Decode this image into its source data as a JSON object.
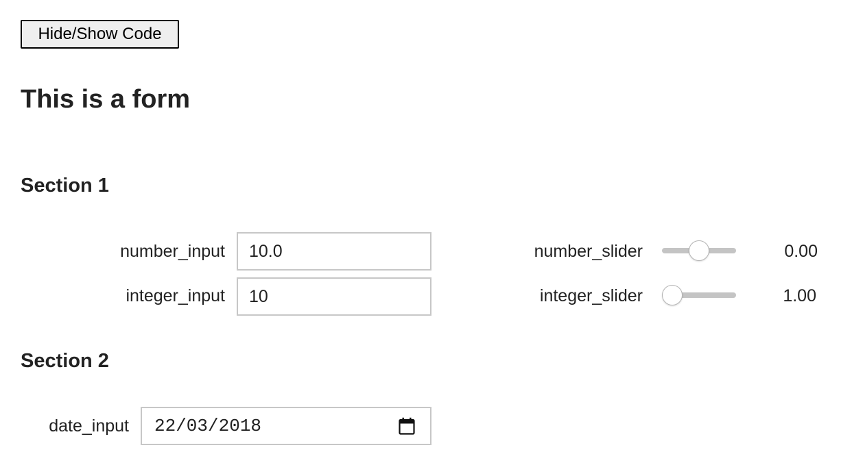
{
  "toolbar": {
    "toggle_code_label": "Hide/Show Code"
  },
  "form": {
    "title": "This is a form",
    "section1": {
      "heading": "Section 1",
      "number_input": {
        "label": "number_input",
        "value": "10.0"
      },
      "integer_input": {
        "label": "integer_input",
        "value": "10"
      },
      "number_slider": {
        "label": "number_slider",
        "value_text": "0.00",
        "position": 0.5
      },
      "integer_slider": {
        "label": "integer_slider",
        "value_text": "1.00",
        "position": 0.0
      }
    },
    "section2": {
      "heading": "Section 2",
      "date_input": {
        "label": "date_input",
        "value": "22/03/2018"
      }
    }
  },
  "icons": {
    "calendar": "calendar-icon"
  },
  "colors": {
    "slider_track": "#c4c4c4",
    "input_border": "#c7c7c7"
  }
}
